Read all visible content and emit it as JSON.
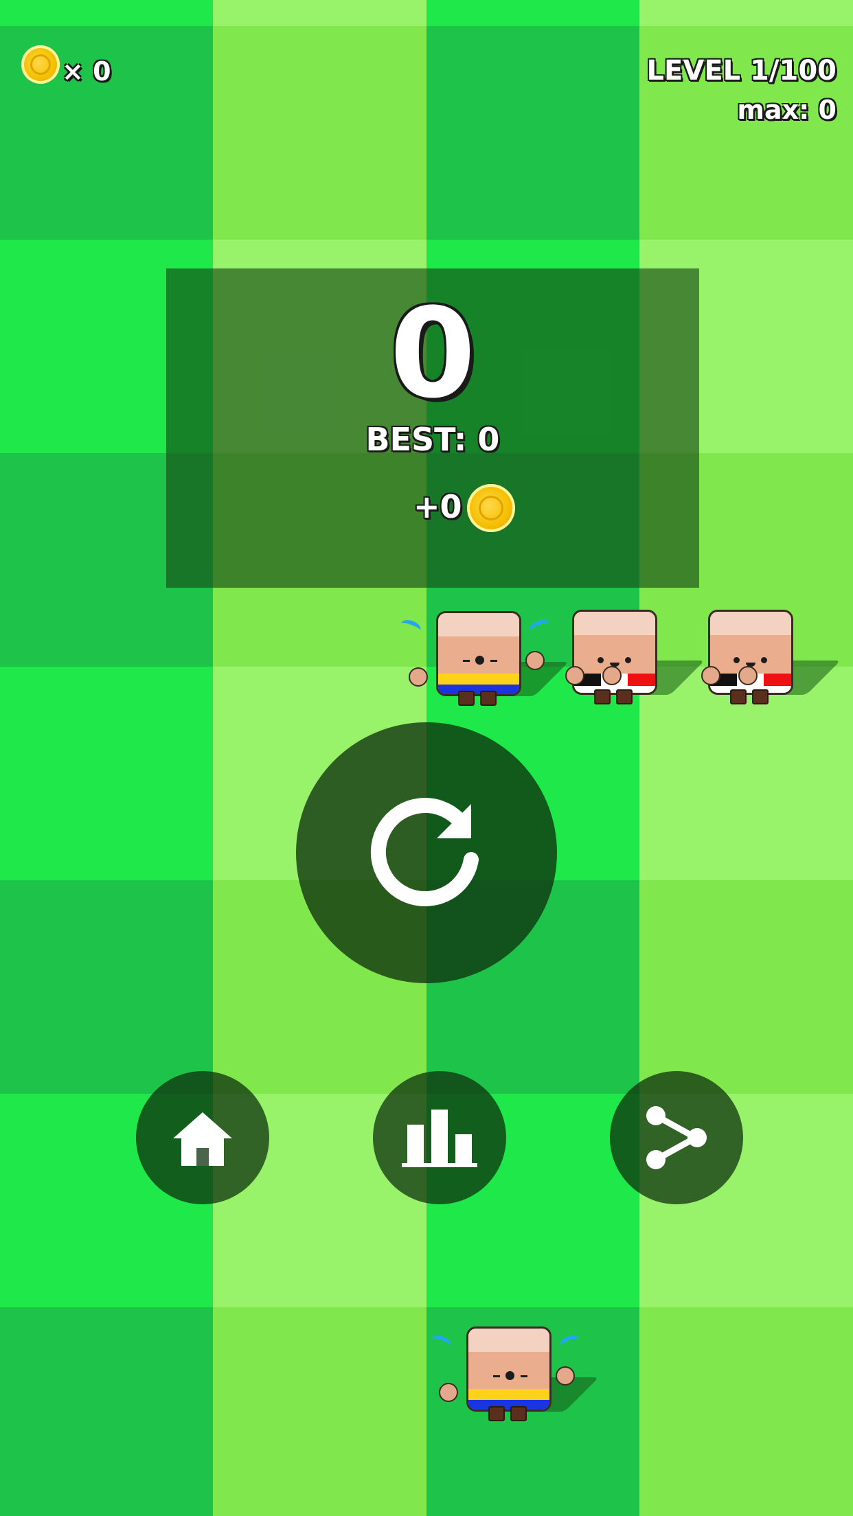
{
  "hud": {
    "coin_count": "× 0",
    "level": "LEVEL 1/100",
    "max": "max: 0"
  },
  "result": {
    "score": "0",
    "best": "BEST: 0",
    "earned": "+0"
  },
  "buttons": {
    "restart": "restart-icon",
    "home": "home-icon",
    "leaderboard": "leaderboard-icon",
    "share": "share-icon"
  },
  "colors": {
    "grass_dark": "#1ec44a",
    "grass_bright": "#1fe84a",
    "grass_lime": "#80e84c",
    "grass_light": "#98f36b",
    "panel": "#145014",
    "coin": "#f4bf00",
    "team_yellow": "#ffd21a",
    "team_blue": "#1a35e0",
    "team_red": "#ee1111",
    "team_black": "#111111"
  }
}
